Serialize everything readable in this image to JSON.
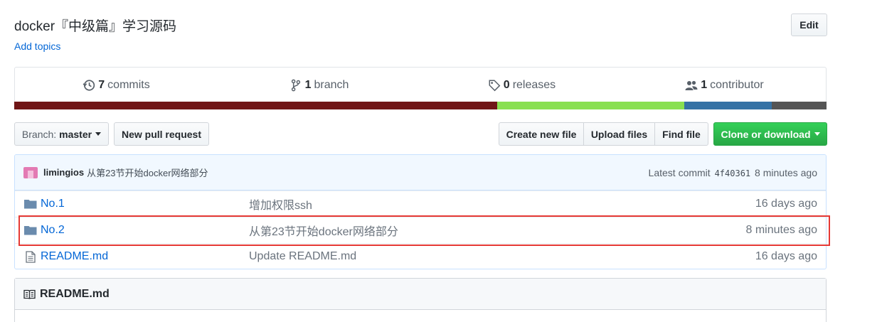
{
  "repo": {
    "description": "docker『中级篇』学习源码",
    "add_topics": "Add topics",
    "edit_label": "Edit"
  },
  "summary": {
    "commits_count": "7",
    "commits_label": "commits",
    "branches_count": "1",
    "branches_label": "branch",
    "releases_count": "0",
    "releases_label": "releases",
    "contributors_count": "1",
    "contributors_label": "contributor"
  },
  "language_bar": [
    {
      "color": "#701516",
      "share": 59.8
    },
    {
      "color": "#89e051",
      "share": 23.2
    },
    {
      "color": "#3572a5",
      "share": 10.8
    },
    {
      "color": "#555555",
      "share": 6.8
    }
  ],
  "toolbar": {
    "branch_label": "Branch:",
    "branch_value": "master",
    "new_pull_request": "New pull request",
    "create_new_file": "Create new file",
    "upload_files": "Upload files",
    "find_file": "Find file",
    "clone_or_download": "Clone or download"
  },
  "latest_commit": {
    "author": "limingios",
    "message": "从第23节开始docker网络部分",
    "prefix": "Latest commit",
    "sha": "4f40361",
    "age": "8 minutes ago"
  },
  "files": [
    {
      "name": "No.1",
      "type": "folder",
      "message": "增加权限ssh",
      "age": "16 days ago"
    },
    {
      "name": "No.2",
      "type": "folder",
      "message": "从第23节开始docker网络部分",
      "age": "8 minutes ago"
    },
    {
      "name": "README.md",
      "type": "file",
      "message": "Update README.md",
      "age": "16 days ago"
    }
  ],
  "readme": {
    "title": "README.md"
  },
  "colors": {
    "link": "#0366d6",
    "clone_green": "#28a745",
    "highlight_red": "#e53935"
  }
}
